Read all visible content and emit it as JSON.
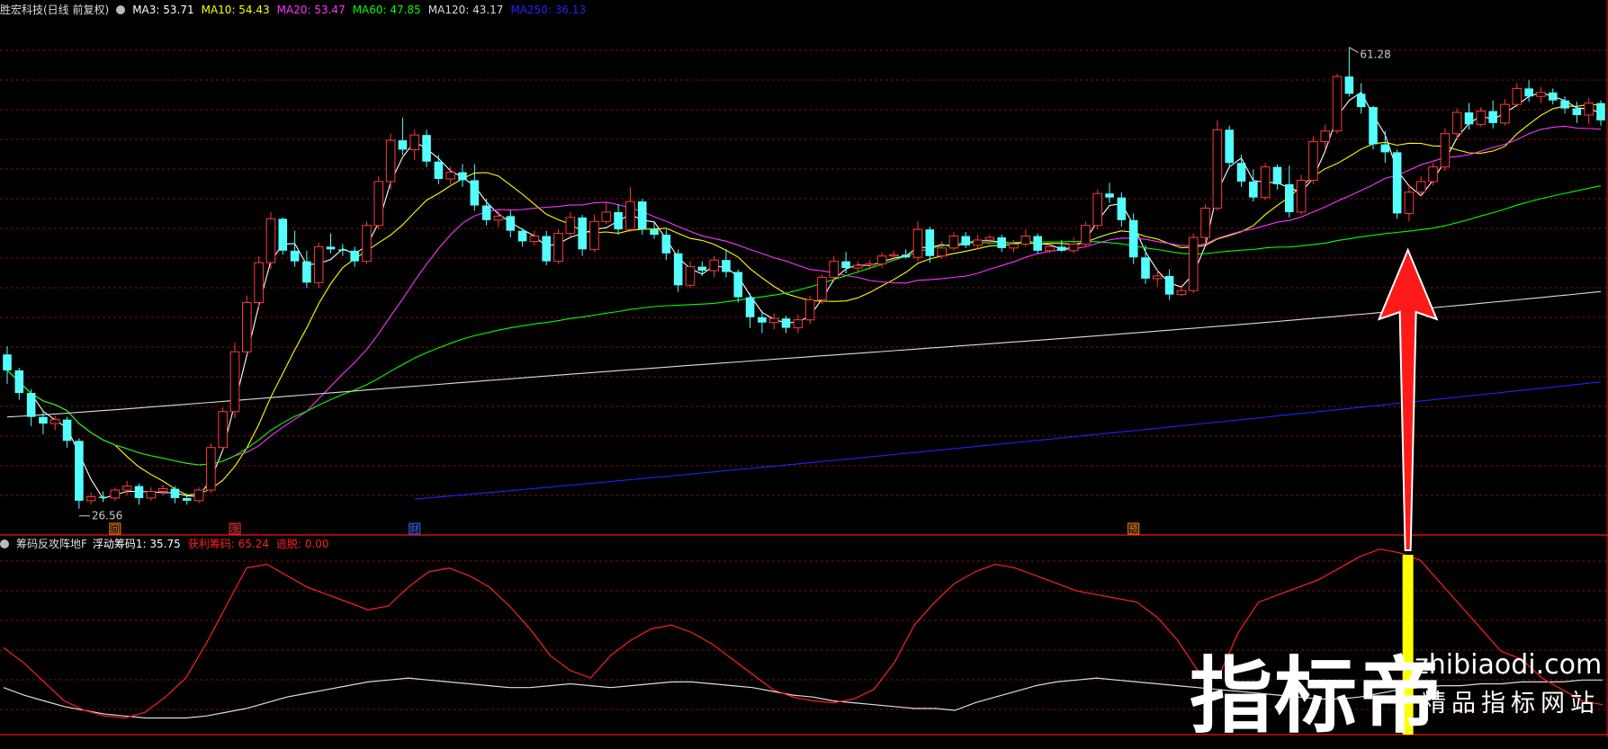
{
  "header": {
    "stock_title": "胜宏科技(日线 前复权)",
    "ma_items": [
      {
        "label": "MA3: 53.71",
        "color": "#ffffff"
      },
      {
        "label": "MA10: 54.43",
        "color": "#ffff00"
      },
      {
        "label": "MA20: 53.47",
        "color": "#ff33ff"
      },
      {
        "label": "MA60: 47.85",
        "color": "#00ff00"
      },
      {
        "label": "MA120: 43.17",
        "color": "#dddddd"
      },
      {
        "label": "MA250: 36.13",
        "color": "#2222ff"
      }
    ]
  },
  "sub_header": {
    "indicator_name": "筹码反攻阵地F",
    "items": [
      {
        "label": "浮动筹码1: 35.75",
        "color": "#ffffff"
      },
      {
        "label": "获利筹码: 65.24",
        "color": "#ff2020"
      },
      {
        "label": "逃脱: 0.00",
        "color": "#ff2020"
      }
    ]
  },
  "annotations": {
    "high_label": "61.28",
    "low_label": "26.56",
    "markers": [
      {
        "text": "回",
        "candle": 9,
        "color": "#ff8800"
      },
      {
        "text": "涨",
        "candle": 19,
        "color": "#ff3030"
      },
      {
        "text": "财",
        "candle": 34,
        "color": "#3366ff"
      },
      {
        "text": "预",
        "candle": 94,
        "color": "#ff8800"
      }
    ]
  },
  "watermark": {
    "big": "指标帝",
    "url": "zhibiaodi.com",
    "sub": "精品指标网站"
  },
  "chart_data": [
    {
      "type": "candlestick",
      "colors": {
        "up": "#ff3b3b",
        "down": "#54ffff"
      },
      "ylim": [
        25.5,
        63.5
      ],
      "candles": [
        [
          38.2,
          38.8,
          36.0,
          37.0
        ],
        [
          37.0,
          37.2,
          34.8,
          35.3
        ],
        [
          35.3,
          35.6,
          32.8,
          33.5
        ],
        [
          33.5,
          34.0,
          32.2,
          33.0
        ],
        [
          33.0,
          33.6,
          32.5,
          33.3
        ],
        [
          33.3,
          33.5,
          31.2,
          31.7
        ],
        [
          31.7,
          31.9,
          26.6,
          27.2
        ],
        [
          27.2,
          27.8,
          26.9,
          27.5
        ],
        [
          27.5,
          27.9,
          27.1,
          27.4
        ],
        [
          27.4,
          28.2,
          27.2,
          28.0
        ],
        [
          28.0,
          28.7,
          27.6,
          28.3
        ],
        [
          28.3,
          28.5,
          26.9,
          27.4
        ],
        [
          27.4,
          28.2,
          27.2,
          27.9
        ],
        [
          27.9,
          28.4,
          27.6,
          28.1
        ],
        [
          28.1,
          28.3,
          27.0,
          27.4
        ],
        [
          27.4,
          27.7,
          26.9,
          27.2
        ],
        [
          27.2,
          28.2,
          27.0,
          28.0
        ],
        [
          28.0,
          31.5,
          27.8,
          31.2
        ],
        [
          31.2,
          34.2,
          31.0,
          33.9
        ],
        [
          33.9,
          39.1,
          33.4,
          38.4
        ],
        [
          38.4,
          42.6,
          38.2,
          42.1
        ],
        [
          42.1,
          45.6,
          41.6,
          45.1
        ],
        [
          45.1,
          48.9,
          44.6,
          48.4
        ],
        [
          48.4,
          48.5,
          45.7,
          46.0
        ],
        [
          46.0,
          47.5,
          44.8,
          45.2
        ],
        [
          45.2,
          46.0,
          43.2,
          43.6
        ],
        [
          43.6,
          46.6,
          43.2,
          46.3
        ],
        [
          46.3,
          47.3,
          45.8,
          46.1
        ],
        [
          46.1,
          46.5,
          45.6,
          46.0
        ],
        [
          46.0,
          46.3,
          44.8,
          45.2
        ],
        [
          45.2,
          48.2,
          45.0,
          47.9
        ],
        [
          47.9,
          51.6,
          47.6,
          51.2
        ],
        [
          51.2,
          54.8,
          50.6,
          54.3
        ],
        [
          54.3,
          56.0,
          53.2,
          53.6
        ],
        [
          53.6,
          55.1,
          52.8,
          54.7
        ],
        [
          54.7,
          55.1,
          52.3,
          52.7
        ],
        [
          52.7,
          53.2,
          51.0,
          51.4
        ],
        [
          51.4,
          52.3,
          51.0,
          51.9
        ],
        [
          51.9,
          52.5,
          50.8,
          51.3
        ],
        [
          51.3,
          52.5,
          49.0,
          49.4
        ],
        [
          49.4,
          49.9,
          47.9,
          48.3
        ],
        [
          48.3,
          49.0,
          47.8,
          48.6
        ],
        [
          48.6,
          49.0,
          47.0,
          47.5
        ],
        [
          47.5,
          47.7,
          46.3,
          46.7
        ],
        [
          46.7,
          47.5,
          46.4,
          47.1
        ],
        [
          47.1,
          47.5,
          44.9,
          45.2
        ],
        [
          45.2,
          47.6,
          45.0,
          47.3
        ],
        [
          47.3,
          48.9,
          47.0,
          48.5
        ],
        [
          48.5,
          48.7,
          45.6,
          46.1
        ],
        [
          46.1,
          48.7,
          45.9,
          48.2
        ],
        [
          48.2,
          49.6,
          48.0,
          48.9
        ],
        [
          48.9,
          49.5,
          47.2,
          47.6
        ],
        [
          47.6,
          50.8,
          47.4,
          49.7
        ],
        [
          49.7,
          49.9,
          47.2,
          47.6
        ],
        [
          47.6,
          48.2,
          46.9,
          47.2
        ],
        [
          47.2,
          47.6,
          45.3,
          45.8
        ],
        [
          45.8,
          46.1,
          42.9,
          43.4
        ],
        [
          43.4,
          45.2,
          43.2,
          44.8
        ],
        [
          44.8,
          45.2,
          44.1,
          44.5
        ],
        [
          44.5,
          45.6,
          44.0,
          45.3
        ],
        [
          45.3,
          46.1,
          44.0,
          44.4
        ],
        [
          44.4,
          44.6,
          42.1,
          42.5
        ],
        [
          42.5,
          42.8,
          40.2,
          41.0
        ],
        [
          41.0,
          41.5,
          39.8,
          40.6
        ],
        [
          40.6,
          41.3,
          40.1,
          40.9
        ],
        [
          40.9,
          41.1,
          39.8,
          40.2
        ],
        [
          40.2,
          41.2,
          39.8,
          40.8
        ],
        [
          40.8,
          42.6,
          40.5,
          42.3
        ],
        [
          42.3,
          44.2,
          42.0,
          44.0
        ],
        [
          44.0,
          45.6,
          43.7,
          45.2
        ],
        [
          45.2,
          45.9,
          44.3,
          44.7
        ],
        [
          44.7,
          45.2,
          44.3,
          44.9
        ],
        [
          44.9,
          45.3,
          44.6,
          45.0
        ],
        [
          45.0,
          45.9,
          44.7,
          45.6
        ],
        [
          45.6,
          46.0,
          45.3,
          45.7
        ],
        [
          45.7,
          46.1,
          45.4,
          45.5
        ],
        [
          45.5,
          48.2,
          45.2,
          47.6
        ],
        [
          47.6,
          47.8,
          45.1,
          45.6
        ],
        [
          45.6,
          46.7,
          45.4,
          46.2
        ],
        [
          46.2,
          47.4,
          46.0,
          47.1
        ],
        [
          47.1,
          47.4,
          46.2,
          46.4
        ],
        [
          46.4,
          47.2,
          46.1,
          46.8
        ],
        [
          46.8,
          47.2,
          46.5,
          47.0
        ],
        [
          47.0,
          47.2,
          45.9,
          46.2
        ],
        [
          46.2,
          46.8,
          45.9,
          46.5
        ],
        [
          46.5,
          47.6,
          46.3,
          47.1
        ],
        [
          47.1,
          47.3,
          45.8,
          46.0
        ],
        [
          46.0,
          46.6,
          45.8,
          46.3
        ],
        [
          46.3,
          46.8,
          45.9,
          46.0
        ],
        [
          46.0,
          47.0,
          45.8,
          46.5
        ],
        [
          46.5,
          48.2,
          46.3,
          47.9
        ],
        [
          47.9,
          50.6,
          47.6,
          50.3
        ],
        [
          50.3,
          51.1,
          49.6,
          50.0
        ],
        [
          50.0,
          50.4,
          47.8,
          48.3
        ],
        [
          48.3,
          48.8,
          45.0,
          45.5
        ],
        [
          45.5,
          46.4,
          43.5,
          43.9
        ],
        [
          43.9,
          44.6,
          43.3,
          44.1
        ],
        [
          44.1,
          44.6,
          42.3,
          42.7
        ],
        [
          42.7,
          43.4,
          42.6,
          43.0
        ],
        [
          43.0,
          47.3,
          42.8,
          47.0
        ],
        [
          47.0,
          49.5,
          46.7,
          49.2
        ],
        [
          49.2,
          55.8,
          49.0,
          55.1
        ],
        [
          55.1,
          55.4,
          52.2,
          52.6
        ],
        [
          52.6,
          53.2,
          50.8,
          51.2
        ],
        [
          51.2,
          52.1,
          49.7,
          50.0
        ],
        [
          50.0,
          52.6,
          49.8,
          52.3
        ],
        [
          52.3,
          52.5,
          50.6,
          51.0
        ],
        [
          51.0,
          52.4,
          48.5,
          48.9
        ],
        [
          48.9,
          51.7,
          48.7,
          51.3
        ],
        [
          51.3,
          54.6,
          51.0,
          54.2
        ],
        [
          54.2,
          55.5,
          53.6,
          55.0
        ],
        [
          55.0,
          59.3,
          54.8,
          59.1
        ],
        [
          59.1,
          61.3,
          57.6,
          57.8
        ],
        [
          57.8,
          58.6,
          56.3,
          56.8
        ],
        [
          56.8,
          56.9,
          53.6,
          54.0
        ],
        [
          54.0,
          55.0,
          52.6,
          53.4
        ],
        [
          53.4,
          53.6,
          48.4,
          48.8
        ],
        [
          48.8,
          51.0,
          48.2,
          50.4
        ],
        [
          50.4,
          51.6,
          50.1,
          51.2
        ],
        [
          51.2,
          52.6,
          50.9,
          52.3
        ],
        [
          52.3,
          55.2,
          52.0,
          54.8
        ],
        [
          54.8,
          56.7,
          54.3,
          56.4
        ],
        [
          56.4,
          57.1,
          55.1,
          55.5
        ],
        [
          55.5,
          56.8,
          55.3,
          56.5
        ],
        [
          56.5,
          57.3,
          55.2,
          55.6
        ],
        [
          55.6,
          57.4,
          55.4,
          57.0
        ],
        [
          57.0,
          58.6,
          56.8,
          58.2
        ],
        [
          58.2,
          58.8,
          57.2,
          57.6
        ],
        [
          57.6,
          58.3,
          57.1,
          57.9
        ],
        [
          57.9,
          58.2,
          57.0,
          57.3
        ],
        [
          57.3,
          57.6,
          56.3,
          56.7
        ],
        [
          56.7,
          57.2,
          55.6,
          56.2
        ],
        [
          56.2,
          57.5,
          55.5,
          57.1
        ],
        [
          57.1,
          57.3,
          55.4,
          55.8
        ]
      ]
    },
    {
      "type": "line",
      "title": "筹码反攻阵地F",
      "ylim": [
        0,
        100
      ],
      "x_count": 80,
      "series": [
        {
          "name": "浮动筹码1",
          "color": "#dddddd",
          "values": [
            21,
            17,
            14,
            11,
            9,
            7,
            6,
            5,
            5,
            5,
            6,
            8,
            10,
            13,
            16,
            18,
            20,
            22,
            24,
            25,
            26,
            25,
            24,
            23,
            22,
            21,
            21,
            22,
            23,
            22,
            21,
            22,
            23,
            24,
            24,
            23,
            22,
            21,
            19,
            17,
            16,
            14,
            13,
            12,
            11,
            10,
            10,
            9,
            13,
            16,
            19,
            22,
            24,
            25,
            26,
            25,
            24,
            23,
            22,
            21,
            20,
            19,
            18,
            17,
            16,
            15,
            15,
            16,
            18,
            20,
            21,
            22,
            22,
            23,
            23,
            24,
            24,
            24,
            25,
            25
          ]
        },
        {
          "name": "获利筹码",
          "color": "#ff2020",
          "values": [
            42,
            34,
            24,
            14,
            9,
            6,
            5,
            8,
            16,
            26,
            44,
            64,
            84,
            86,
            80,
            74,
            70,
            66,
            62,
            64,
            74,
            82,
            84,
            80,
            74,
            64,
            52,
            38,
            30,
            26,
            38,
            46,
            52,
            54,
            50,
            44,
            36,
            28,
            20,
            16,
            14,
            13,
            15,
            20,
            34,
            54,
            66,
            76,
            82,
            86,
            84,
            80,
            76,
            72,
            70,
            68,
            66,
            58,
            46,
            30,
            26,
            50,
            66,
            70,
            74,
            78,
            84,
            90,
            94,
            92,
            88,
            76,
            64,
            52,
            40,
            36,
            26,
            20,
            14,
            12
          ]
        }
      ]
    }
  ]
}
